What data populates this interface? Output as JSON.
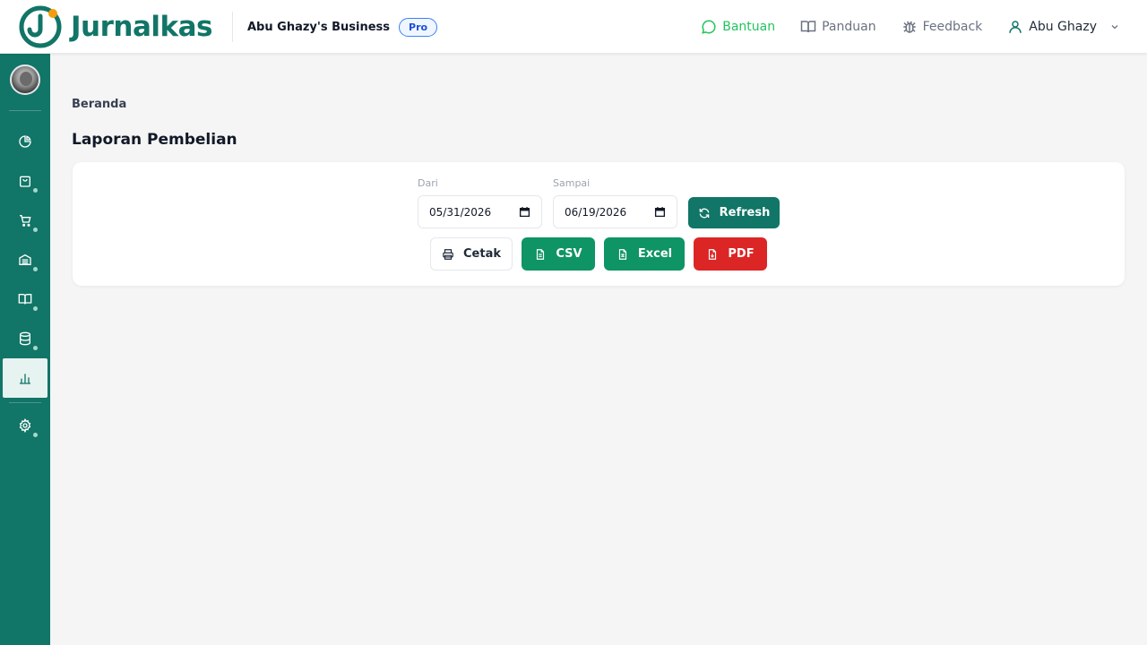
{
  "header": {
    "app_name": "Jurnalkas",
    "business_name": "Abu Ghazy's Business",
    "plan_badge": "Pro",
    "links": {
      "help": "Bantuan",
      "guide": "Panduan",
      "feedback": "Feedback",
      "user": "Abu Ghazy"
    }
  },
  "sidebar": {
    "items": [
      {
        "icon": "dashboard-pie-icon",
        "has_dot": false
      },
      {
        "icon": "shopping-bag-icon",
        "has_dot": true
      },
      {
        "icon": "cart-icon",
        "has_dot": true
      },
      {
        "icon": "inventory-icon",
        "has_dot": true
      },
      {
        "icon": "book-icon",
        "has_dot": true
      },
      {
        "icon": "database-icon",
        "has_dot": true
      },
      {
        "icon": "bar-chart-icon",
        "active": true
      },
      {
        "icon": "settings-gear-icon",
        "has_dot": true
      }
    ]
  },
  "main": {
    "breadcrumb": "Beranda",
    "title": "Laporan Pembelian",
    "filters": {
      "from_label": "Dari",
      "from_value": "05/31/2026",
      "to_label": "Sampai",
      "to_value": "06/19/2026",
      "refresh_label": "Refresh"
    },
    "export": {
      "print_label": "Cetak",
      "csv_label": "CSV",
      "excel_label": "Excel",
      "pdf_label": "PDF"
    }
  },
  "colors": {
    "brand": "#117567",
    "accent_orange": "#f59e0b",
    "help_green": "#22c55e",
    "export_green": "#0f9465",
    "pdf_red": "#dc2626"
  }
}
